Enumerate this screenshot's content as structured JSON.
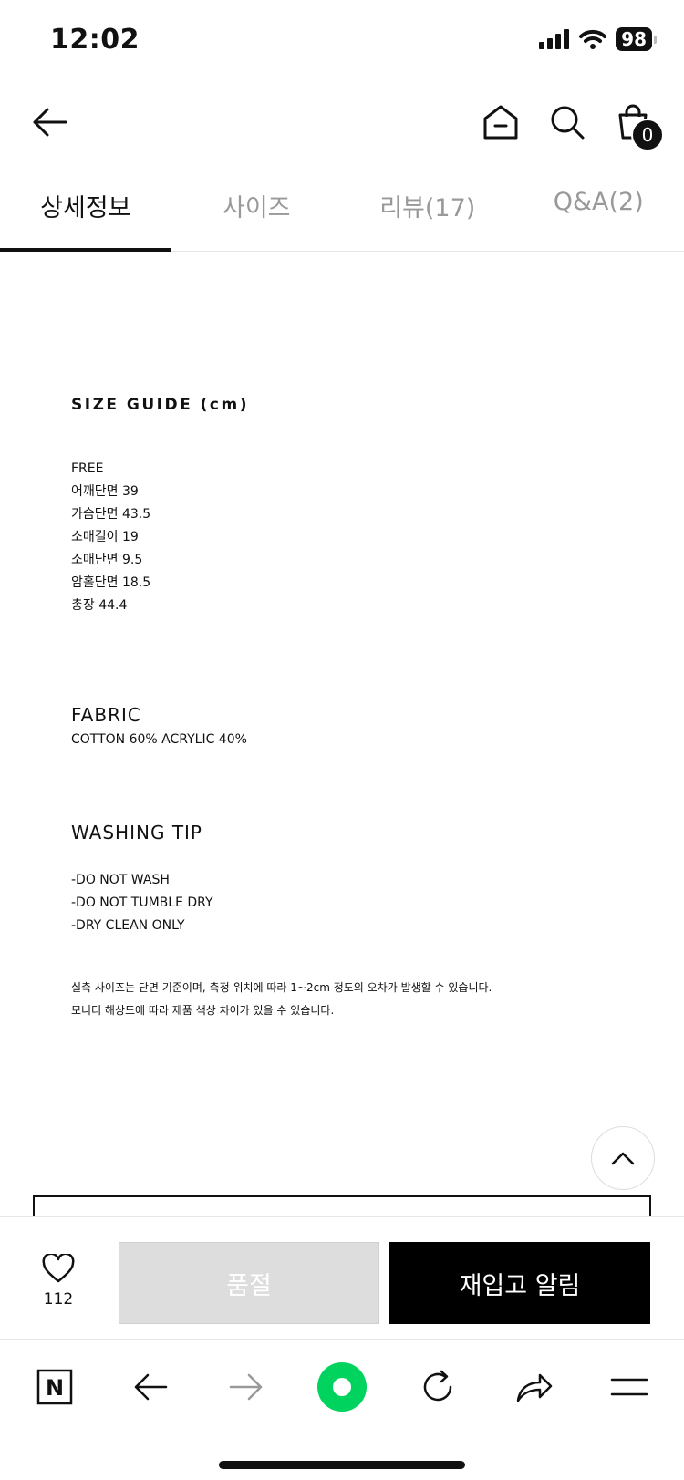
{
  "status": {
    "time": "12:02",
    "battery": "98"
  },
  "header": {
    "cart_count": "0"
  },
  "tabs": [
    {
      "label": "상세정보"
    },
    {
      "label": "사이즈"
    },
    {
      "label": "리뷰(17)"
    },
    {
      "label": "Q&A(2)"
    }
  ],
  "size_guide": {
    "title": "SIZE GUIDE (cm)",
    "lines": [
      "FREE",
      "어깨단면  39",
      "가슴단면  43.5",
      "소매길이 19",
      "소매단면 9.5",
      "암홀단면 18.5",
      "총장  44.4"
    ]
  },
  "fabric": {
    "title": "FABRIC",
    "value": "COTTON 60% ACRYLIC 40%"
  },
  "washing": {
    "title": "WASHING TIP",
    "lines": [
      "-DO NOT WASH",
      "-DO NOT TUMBLE DRY",
      "-DRY CLEAN ONLY"
    ]
  },
  "notes": [
    "실측 사이즈는 단면 기준이며, 측정 위치에 따라 1~2cm 정도의 오차가 발생할 수 있습니다.",
    "모니터 해상도에 따라 제품 색상 차이가 있을 수 있습니다."
  ],
  "actions": {
    "wish_count": "112",
    "soldout_label": "품절",
    "restock_label": "재입고 알림"
  },
  "browser": {
    "logo": "N"
  },
  "colors": {
    "accent_green": "#00d45f",
    "black": "#000000"
  }
}
